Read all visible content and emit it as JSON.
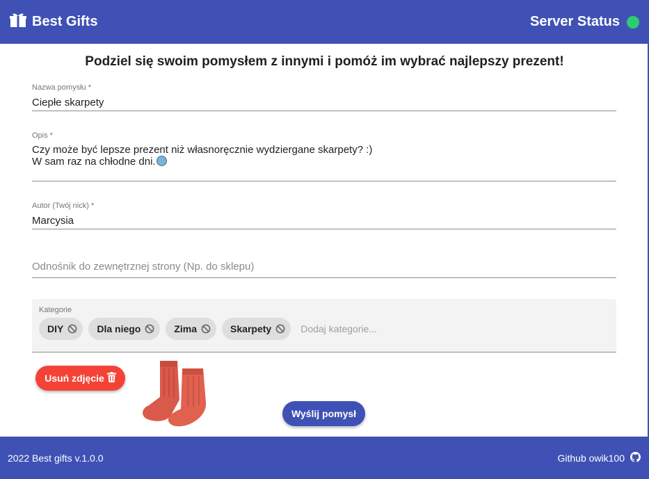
{
  "header": {
    "brand_icon": "gift-icon",
    "title": "Best Gifts",
    "status_label": "Server Status",
    "status_color": "#2ecc71"
  },
  "main": {
    "heading": "Podziel się swoim pomysłem z innymi i pomóż im wybrać najlepszy prezent!",
    "name_field": {
      "label": "Nazwa pomysłu *",
      "value": "Ciepłe skarpety"
    },
    "description_field": {
      "label": "Opis *",
      "line1": "Czy może być lepsze prezent niż własnoręcznie wydziergane skarpety? :)",
      "line2": "W sam raz na chłodne dni.",
      "emoji_icon": "cold-face-emoji-icon"
    },
    "author_field": {
      "label": "Autor (Twój nick) *",
      "value": "Marcysia"
    },
    "link_field": {
      "placeholder": "Odnośnik do zewnętrznej strony (Np. do sklepu)",
      "value": ""
    },
    "categories": {
      "label": "Kategorie",
      "chips": [
        "DIY",
        "Dla niego",
        "Zima",
        "Skarpety"
      ],
      "remove_icon": "block-icon",
      "input_placeholder": "Dodaj kategorie..."
    },
    "remove_photo_button": {
      "label": "Usuń zdjęcie",
      "icon": "trash-icon"
    },
    "photo": {
      "subject": "red-wool-socks",
      "color": "#e0614f"
    },
    "submit_button": {
      "label": "Wyślij pomysł"
    }
  },
  "footer": {
    "copyright": "2022 Best gifts v.1.0.0",
    "github_label": "Github owik100",
    "github_icon": "github-icon"
  },
  "colors": {
    "primary": "#3f51b5",
    "danger": "#f44336",
    "status_ok": "#2ecc71"
  }
}
